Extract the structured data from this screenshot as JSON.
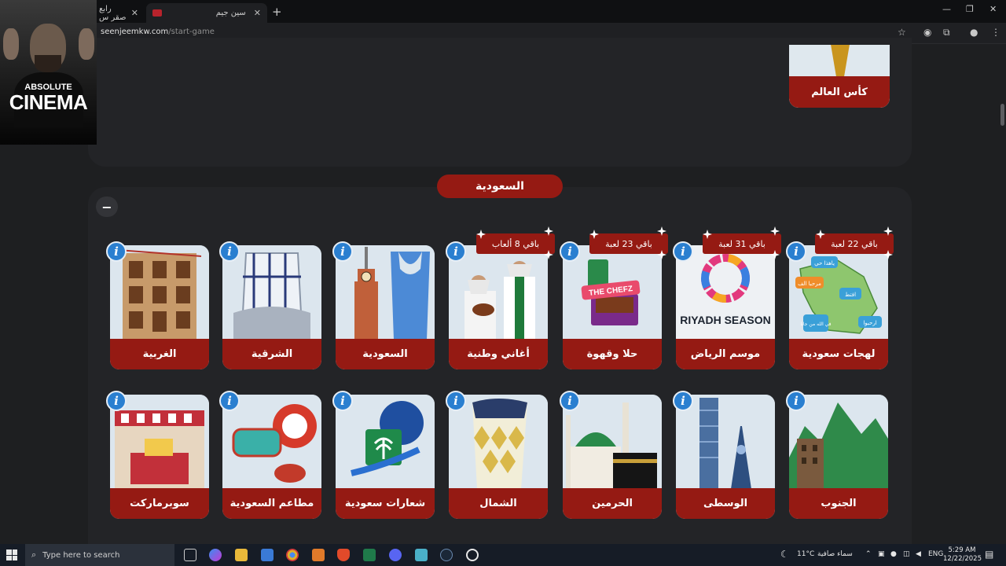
{
  "browser": {
    "tabs": [
      {
        "title": "رابع صقر س",
        "active": false
      },
      {
        "title": "سين جيم",
        "active": true
      }
    ],
    "url_domain": "seenjeemkw.com",
    "url_path": "/start-game"
  },
  "overlay": {
    "line1": "ABSOLUTE",
    "line2": "CINEMA"
  },
  "top_category": {
    "label": "كأس العالم"
  },
  "section": {
    "title": "السعودية",
    "collapse_symbol": "−"
  },
  "info_symbol": "i",
  "row1": [
    {
      "label": "لهجات سعودية",
      "badge": "باقي 22 لعبة"
    },
    {
      "label": "موسم الرياض",
      "badge": "باقي 31 لعبة"
    },
    {
      "label": "حلا وقهوة",
      "badge": "باقي 23 لعبة"
    },
    {
      "label": "أغاني وطنية",
      "badge": "باقي 8 ألعاب"
    },
    {
      "label": "السعودية",
      "badge": ""
    },
    {
      "label": "الشرقية",
      "badge": ""
    },
    {
      "label": "الغربية",
      "badge": ""
    }
  ],
  "row2": [
    {
      "label": "الجنوب"
    },
    {
      "label": "الوسطى"
    },
    {
      "label": "الحرمين"
    },
    {
      "label": "الشمال"
    },
    {
      "label": "شعارات سعودية"
    },
    {
      "label": "مطاعم السعودية"
    },
    {
      "label": "سوبرماركت"
    }
  ],
  "art_text": {
    "riyadh": "RIYADH SEASON",
    "chefz": "THE CHEFZ",
    "dialects": [
      "ياهذا حي",
      "مرحبا الف",
      "افتط",
      "في الله من جانا",
      "ارحبوا"
    ]
  },
  "taskbar": {
    "search_placeholder": "Type here to search",
    "weather": "11°C",
    "weather_desc": "سماء صافية",
    "lang": "ENG",
    "time": "5:29 AM",
    "date": "12/22/2025"
  },
  "colors": {
    "accent": "#951a13",
    "info": "#2a7fd0",
    "page_bg": "#1e1f21",
    "panel_bg": "#232427"
  }
}
